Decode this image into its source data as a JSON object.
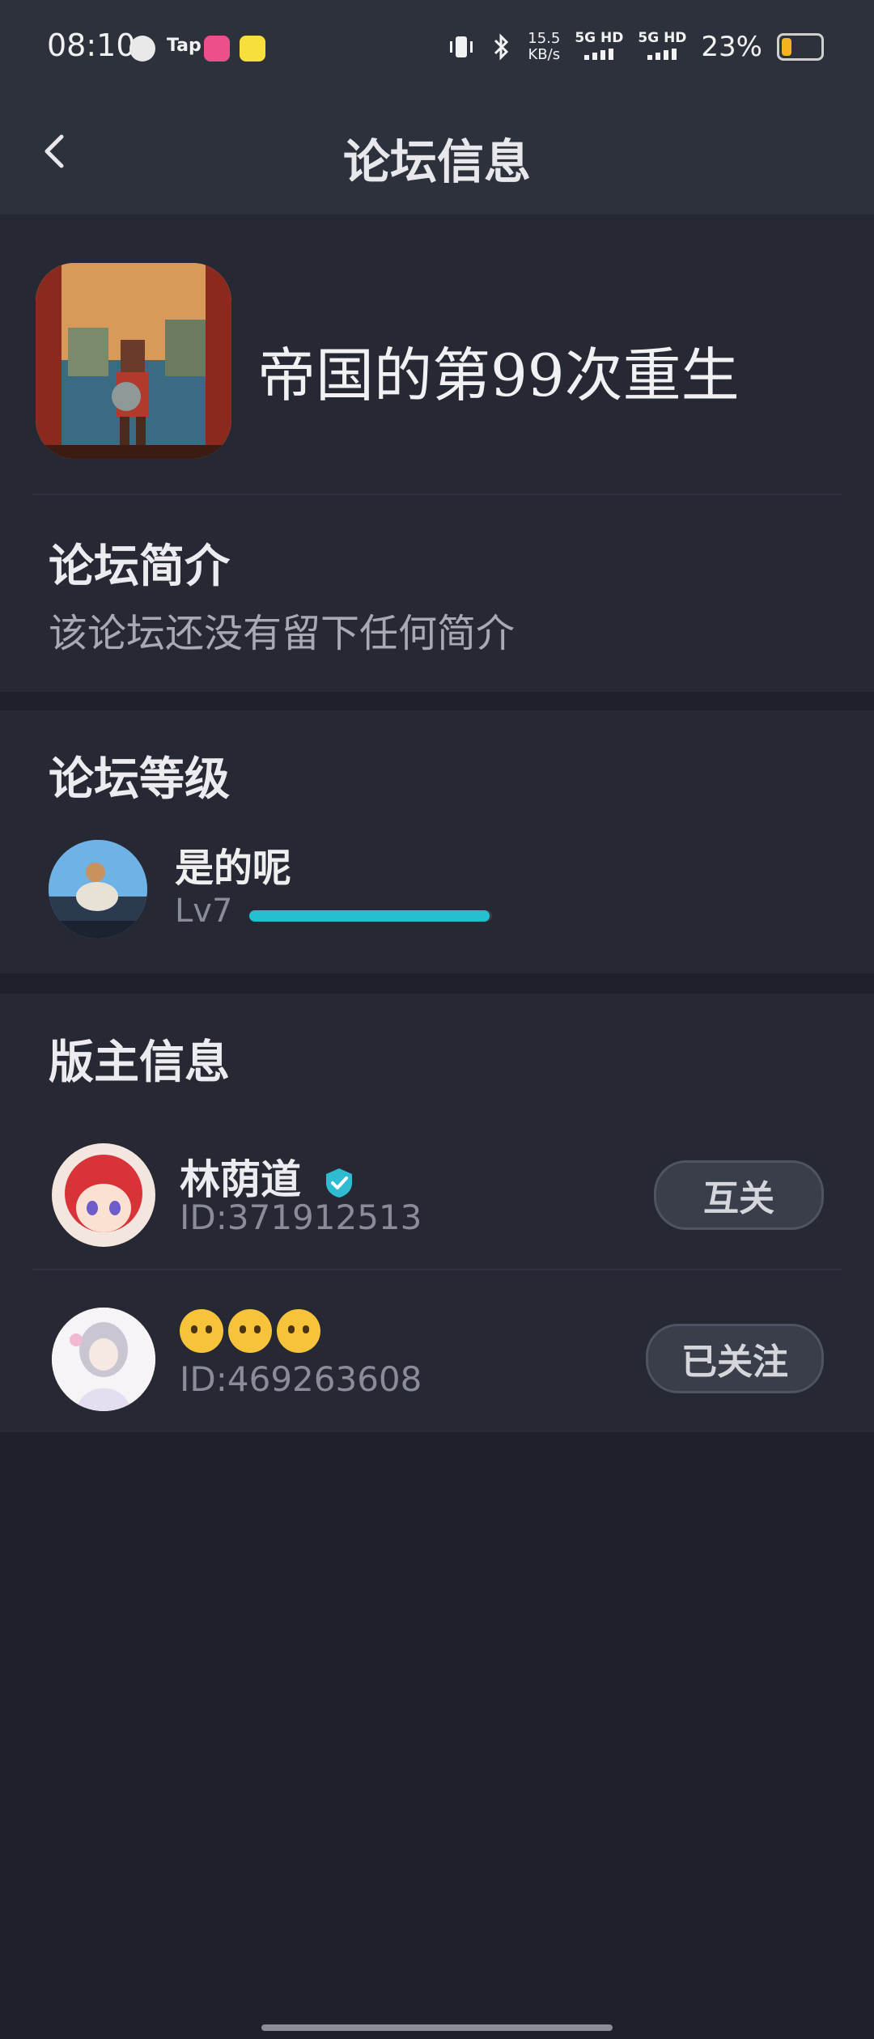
{
  "status_bar": {
    "time": "08:10",
    "net_speed_value": "15.5",
    "net_speed_unit": "KB/s",
    "sim1": "5G HD",
    "sim2": "5G HD",
    "battery": "23%",
    "battery_level": 0.23,
    "icons": [
      "globe-icon",
      "tap-icon",
      "pink-app-icon",
      "qq-music-icon",
      "vibrate-icon",
      "bluetooth-icon",
      "signal-icon",
      "battery-icon"
    ]
  },
  "header": {
    "title": "论坛信息",
    "back_icon": "chevron-left-icon"
  },
  "forum": {
    "name": "帝国的第99次重生",
    "intro_title": "论坛简介",
    "intro_text": "该论坛还没有留下任何简介"
  },
  "level": {
    "title": "论坛等级",
    "name": "是的呢",
    "lv": "Lv7",
    "progress": 0.99
  },
  "moderators": {
    "title": "版主信息",
    "items": [
      {
        "name": "林荫道",
        "verified": true,
        "id": "ID:371912513",
        "button": "互关"
      },
      {
        "name": "🤨🤨🤨",
        "verified": false,
        "id": "ID:469263608",
        "button": "已关注"
      }
    ]
  },
  "colors": {
    "background": "#1f2029",
    "card": "#262833",
    "header": "#2c313c",
    "accent": "#25c0cf",
    "muted_text": "#8a8d99"
  }
}
